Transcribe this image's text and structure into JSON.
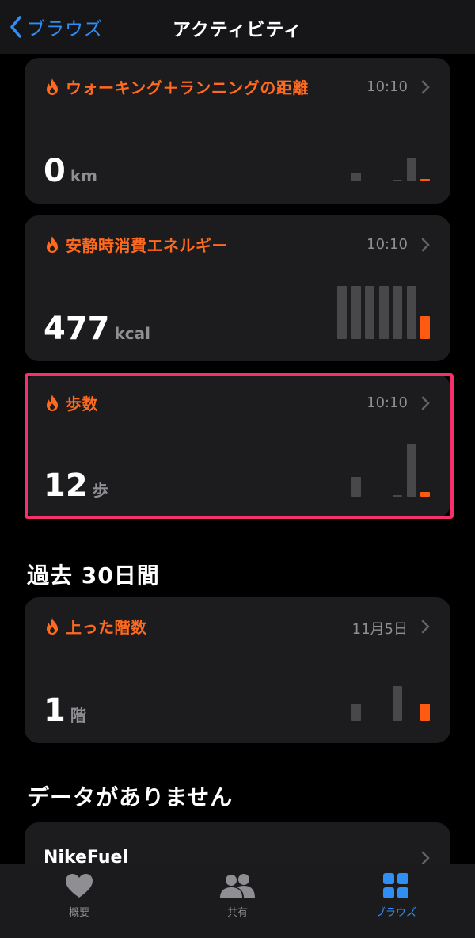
{
  "nav": {
    "back_label": "ブラウズ",
    "title": "アクティビティ"
  },
  "cards": [
    {
      "title": "ウォーキング＋ランニングの距離",
      "time": "10:10",
      "value": "0",
      "unit": "km",
      "bars": [
        0.14,
        0,
        0,
        0.02,
        0.38,
        0.04
      ],
      "accent_index": 5
    },
    {
      "title": "安静時消費エネルギー",
      "time": "10:10",
      "value": "477",
      "unit": "kcal",
      "bars": [
        0.84,
        0.84,
        0.84,
        0.84,
        0.84,
        0.84,
        0.36
      ],
      "accent_index": 6
    },
    {
      "title": "歩数",
      "time": "10:10",
      "value": "12",
      "unit": "歩",
      "bars": [
        0.31,
        0,
        0,
        0.02,
        0.84,
        0.08
      ],
      "accent_index": 5
    }
  ],
  "past30": {
    "section_title": "過去 30日間",
    "card": {
      "title": "上った階数",
      "time": "11月5日",
      "value": "1",
      "unit": "階",
      "bars": [
        0.3,
        0,
        0,
        0.6,
        0,
        0.3
      ],
      "accent_index": 5
    }
  },
  "no_data": {
    "section_title": "データがありません",
    "item_label": "NikeFuel"
  },
  "tabs": [
    {
      "label": "概要",
      "icon": "heart-icon",
      "active": false
    },
    {
      "label": "共有",
      "icon": "people-icon",
      "active": false
    },
    {
      "label": "ブラウズ",
      "icon": "grid-icon",
      "active": true
    }
  ],
  "colors": {
    "accent": "#ff6a1f",
    "bar_accent": "#ff5a12",
    "bar_default": "#48484a",
    "highlight": "#f5306a",
    "link": "#2f8ff5"
  }
}
